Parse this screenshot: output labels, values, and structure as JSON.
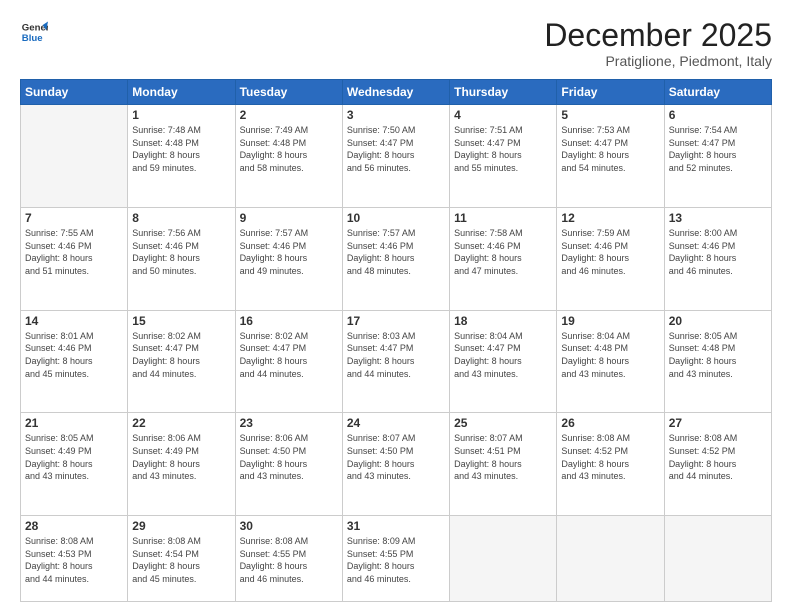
{
  "logo": {
    "line1": "General",
    "line2": "Blue"
  },
  "header": {
    "month": "December 2025",
    "location": "Pratiglione, Piedmont, Italy"
  },
  "weekdays": [
    "Sunday",
    "Monday",
    "Tuesday",
    "Wednesday",
    "Thursday",
    "Friday",
    "Saturday"
  ],
  "weeks": [
    [
      {
        "day": "",
        "info": ""
      },
      {
        "day": "1",
        "info": "Sunrise: 7:48 AM\nSunset: 4:48 PM\nDaylight: 8 hours\nand 59 minutes."
      },
      {
        "day": "2",
        "info": "Sunrise: 7:49 AM\nSunset: 4:48 PM\nDaylight: 8 hours\nand 58 minutes."
      },
      {
        "day": "3",
        "info": "Sunrise: 7:50 AM\nSunset: 4:47 PM\nDaylight: 8 hours\nand 56 minutes."
      },
      {
        "day": "4",
        "info": "Sunrise: 7:51 AM\nSunset: 4:47 PM\nDaylight: 8 hours\nand 55 minutes."
      },
      {
        "day": "5",
        "info": "Sunrise: 7:53 AM\nSunset: 4:47 PM\nDaylight: 8 hours\nand 54 minutes."
      },
      {
        "day": "6",
        "info": "Sunrise: 7:54 AM\nSunset: 4:47 PM\nDaylight: 8 hours\nand 52 minutes."
      }
    ],
    [
      {
        "day": "7",
        "info": "Sunrise: 7:55 AM\nSunset: 4:46 PM\nDaylight: 8 hours\nand 51 minutes."
      },
      {
        "day": "8",
        "info": "Sunrise: 7:56 AM\nSunset: 4:46 PM\nDaylight: 8 hours\nand 50 minutes."
      },
      {
        "day": "9",
        "info": "Sunrise: 7:57 AM\nSunset: 4:46 PM\nDaylight: 8 hours\nand 49 minutes."
      },
      {
        "day": "10",
        "info": "Sunrise: 7:57 AM\nSunset: 4:46 PM\nDaylight: 8 hours\nand 48 minutes."
      },
      {
        "day": "11",
        "info": "Sunrise: 7:58 AM\nSunset: 4:46 PM\nDaylight: 8 hours\nand 47 minutes."
      },
      {
        "day": "12",
        "info": "Sunrise: 7:59 AM\nSunset: 4:46 PM\nDaylight: 8 hours\nand 46 minutes."
      },
      {
        "day": "13",
        "info": "Sunrise: 8:00 AM\nSunset: 4:46 PM\nDaylight: 8 hours\nand 46 minutes."
      }
    ],
    [
      {
        "day": "14",
        "info": "Sunrise: 8:01 AM\nSunset: 4:46 PM\nDaylight: 8 hours\nand 45 minutes."
      },
      {
        "day": "15",
        "info": "Sunrise: 8:02 AM\nSunset: 4:47 PM\nDaylight: 8 hours\nand 44 minutes."
      },
      {
        "day": "16",
        "info": "Sunrise: 8:02 AM\nSunset: 4:47 PM\nDaylight: 8 hours\nand 44 minutes."
      },
      {
        "day": "17",
        "info": "Sunrise: 8:03 AM\nSunset: 4:47 PM\nDaylight: 8 hours\nand 44 minutes."
      },
      {
        "day": "18",
        "info": "Sunrise: 8:04 AM\nSunset: 4:47 PM\nDaylight: 8 hours\nand 43 minutes."
      },
      {
        "day": "19",
        "info": "Sunrise: 8:04 AM\nSunset: 4:48 PM\nDaylight: 8 hours\nand 43 minutes."
      },
      {
        "day": "20",
        "info": "Sunrise: 8:05 AM\nSunset: 4:48 PM\nDaylight: 8 hours\nand 43 minutes."
      }
    ],
    [
      {
        "day": "21",
        "info": "Sunrise: 8:05 AM\nSunset: 4:49 PM\nDaylight: 8 hours\nand 43 minutes."
      },
      {
        "day": "22",
        "info": "Sunrise: 8:06 AM\nSunset: 4:49 PM\nDaylight: 8 hours\nand 43 minutes."
      },
      {
        "day": "23",
        "info": "Sunrise: 8:06 AM\nSunset: 4:50 PM\nDaylight: 8 hours\nand 43 minutes."
      },
      {
        "day": "24",
        "info": "Sunrise: 8:07 AM\nSunset: 4:50 PM\nDaylight: 8 hours\nand 43 minutes."
      },
      {
        "day": "25",
        "info": "Sunrise: 8:07 AM\nSunset: 4:51 PM\nDaylight: 8 hours\nand 43 minutes."
      },
      {
        "day": "26",
        "info": "Sunrise: 8:08 AM\nSunset: 4:52 PM\nDaylight: 8 hours\nand 43 minutes."
      },
      {
        "day": "27",
        "info": "Sunrise: 8:08 AM\nSunset: 4:52 PM\nDaylight: 8 hours\nand 44 minutes."
      }
    ],
    [
      {
        "day": "28",
        "info": "Sunrise: 8:08 AM\nSunset: 4:53 PM\nDaylight: 8 hours\nand 44 minutes."
      },
      {
        "day": "29",
        "info": "Sunrise: 8:08 AM\nSunset: 4:54 PM\nDaylight: 8 hours\nand 45 minutes."
      },
      {
        "day": "30",
        "info": "Sunrise: 8:08 AM\nSunset: 4:55 PM\nDaylight: 8 hours\nand 46 minutes."
      },
      {
        "day": "31",
        "info": "Sunrise: 8:09 AM\nSunset: 4:55 PM\nDaylight: 8 hours\nand 46 minutes."
      },
      {
        "day": "",
        "info": ""
      },
      {
        "day": "",
        "info": ""
      },
      {
        "day": "",
        "info": ""
      }
    ]
  ]
}
